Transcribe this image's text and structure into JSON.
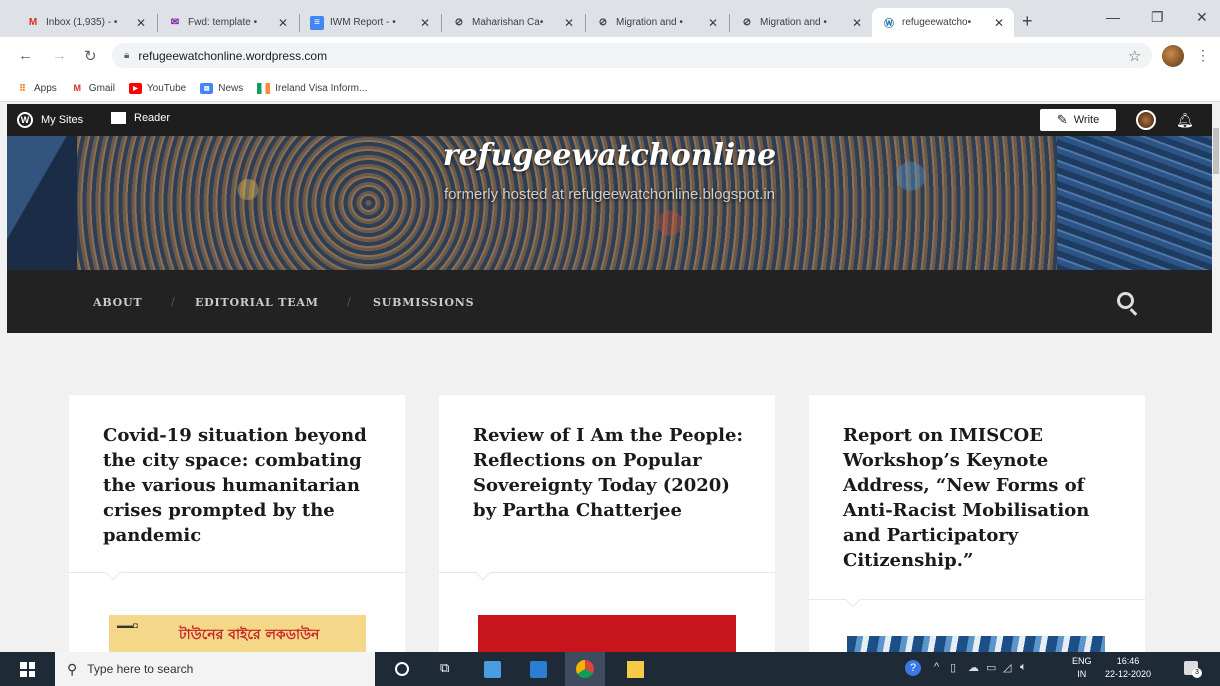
{
  "tabs": [
    {
      "title": "Inbox (1,935) - •",
      "favicon": "gmail-icon",
      "color": "#d93025"
    },
    {
      "title": "Fwd: template •",
      "favicon": "yahoo-mail-icon",
      "color": "#7b1fa2"
    },
    {
      "title": "IWM Report - •",
      "favicon": "docs-icon",
      "color": "#4285f4"
    },
    {
      "title": "Maharishan Ca•",
      "favicon": "globe-icon",
      "color": "#3c4043"
    },
    {
      "title": "Migration and •",
      "favicon": "globe-icon",
      "color": "#3c4043"
    },
    {
      "title": "Migration and •",
      "favicon": "globe-icon",
      "color": "#3c4043"
    },
    {
      "title": "refugeewatcho•",
      "favicon": "wordpress-icon",
      "color": "#21759b"
    }
  ],
  "address": {
    "url": "refugeewatchonline.wordpress.com"
  },
  "bookmarks": [
    {
      "label": "Apps",
      "icon": "apps-grid-icon",
      "color": "#e8710a"
    },
    {
      "label": "Gmail",
      "icon": "gmail-icon",
      "color": "#d93025"
    },
    {
      "label": "YouTube",
      "icon": "youtube-icon",
      "color": "#ff0000"
    },
    {
      "label": "News",
      "icon": "news-icon",
      "color": "#4285f4"
    },
    {
      "label": "Ireland Visa Inform...",
      "icon": "ireland-flag-icon",
      "color": "#169b62"
    }
  ],
  "wpbar": {
    "my_sites": "My Sites",
    "reader": "Reader",
    "write": "Write"
  },
  "site": {
    "title": "refugeewatchonline",
    "description": "formerly hosted at refugeewatchonline.blogspot.in"
  },
  "nav": {
    "items": [
      "ABOUT",
      "EDITORIAL TEAM",
      "SUBMISSIONS"
    ]
  },
  "posts": [
    {
      "title": "Covid-19 situation beyond the city space: combating the various humanitarian crises prompted by the pandemic",
      "thumb_text": "টাউনের বাইরে লকডাউন"
    },
    {
      "title": "Review of I Am the People: Reflections on Popular Sovereignty Today (2020) by Partha Chatterjee"
    },
    {
      "title": "Report on IMISCOE Workshop’s Keynote Address, “New Forms of Anti-Racist Mobilisation and Participatory Citizenship.”"
    }
  ],
  "taskbar": {
    "search_placeholder": "Type here to search",
    "lang": "ENG",
    "lang_sub": "IN",
    "time": "16:46",
    "date": "22-12-2020",
    "notifications": "3"
  },
  "colors": {
    "wp_bar": "#1e1e1e",
    "nav_bg": "#222222",
    "page_bg": "#f1f1f1"
  }
}
